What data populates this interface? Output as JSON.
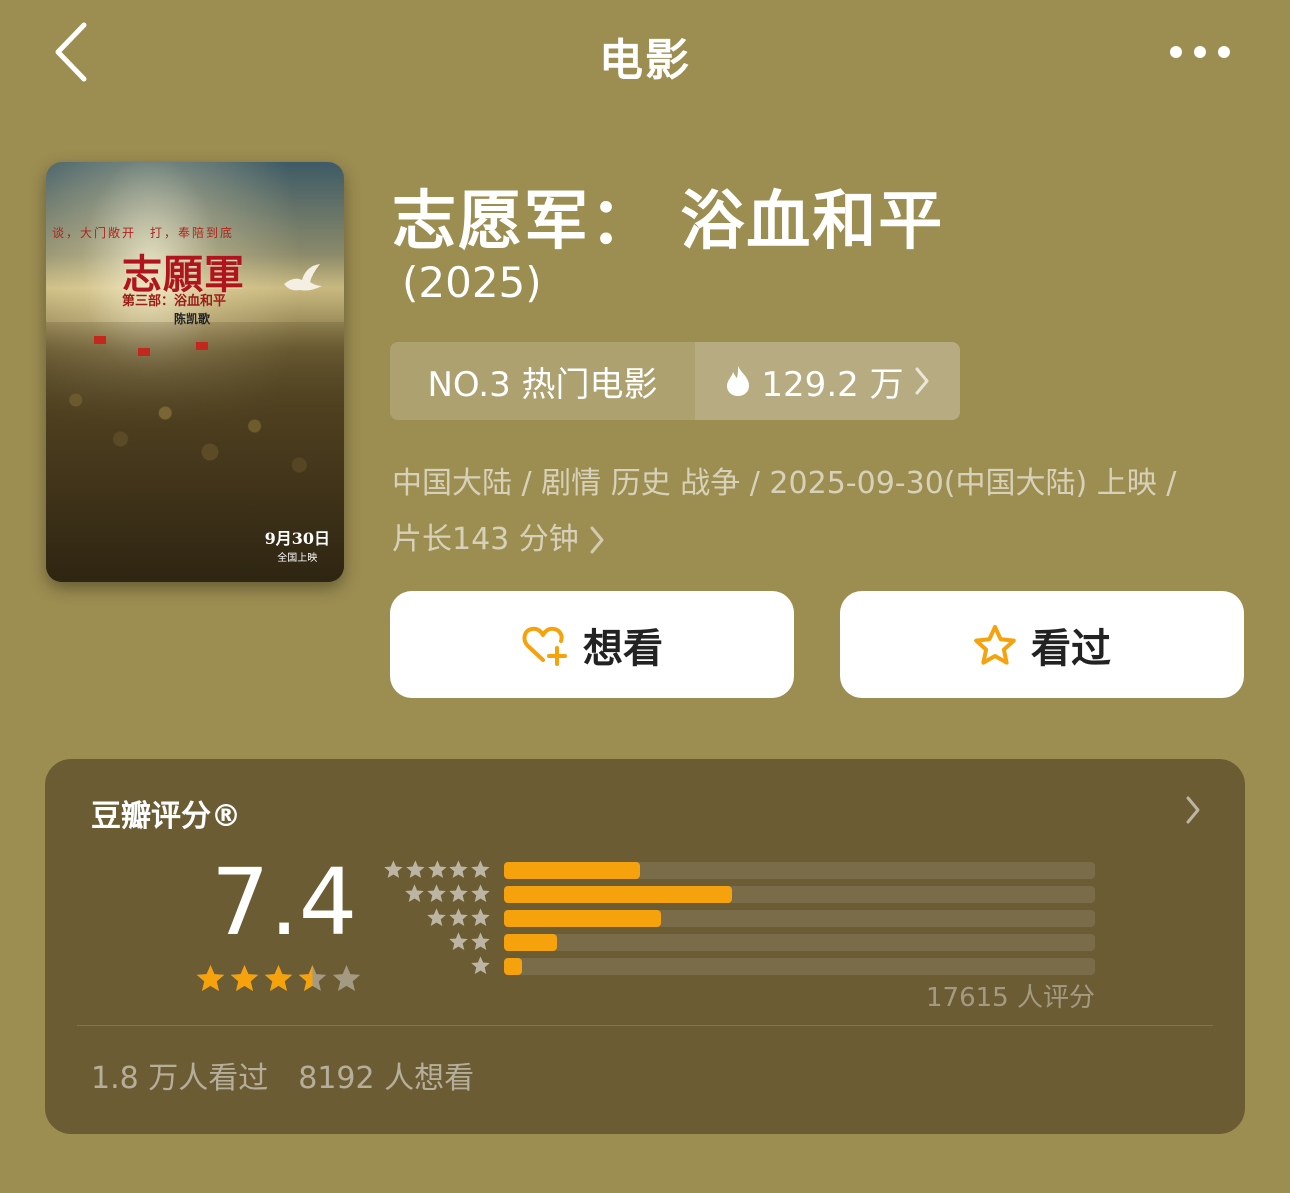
{
  "nav": {
    "title": "电影"
  },
  "poster": {
    "tagline": "谈，大门敞开　打，奉陪到底",
    "title": "志願軍",
    "subtitle": "第三部：浴血和平",
    "director": "陈凯歌",
    "date_line1": "9月30日",
    "date_line2": "全国上映"
  },
  "movie": {
    "title": "志愿军： 浴血和平",
    "year": "(2025)",
    "rank_label": "NO.3 热门电影",
    "heat_value": "129.2 万",
    "meta_line1": "中国大陆 / 剧情 历史 战争 / 2025-09-30(中国大陆) 上映 /",
    "meta_line2": "片长143 分钟"
  },
  "actions": {
    "want_label": "想看",
    "seen_label": "看过"
  },
  "rating": {
    "title": "豆瓣评分®",
    "score": "7.4",
    "score_stars": 3.5,
    "distribution": [
      {
        "stars": 5,
        "fraction": 0.23
      },
      {
        "stars": 4,
        "fraction": 0.385
      },
      {
        "stars": 3,
        "fraction": 0.265
      },
      {
        "stars": 2,
        "fraction": 0.09
      },
      {
        "stars": 1,
        "fraction": 0.03
      }
    ],
    "count_text": "17615 人评分",
    "seen_text": "1.8 万人看过",
    "want_text": "8192 人想看"
  },
  "colors": {
    "background": "#9c8d51",
    "card": "#6b5c34",
    "accent": "#f5a20c",
    "button": "#ffffff"
  },
  "icons": {
    "back": "chevron-left-icon",
    "more": "more-dots-icon",
    "heat": "flame-icon",
    "want": "heart-plus-icon",
    "seen": "star-outline-icon"
  }
}
